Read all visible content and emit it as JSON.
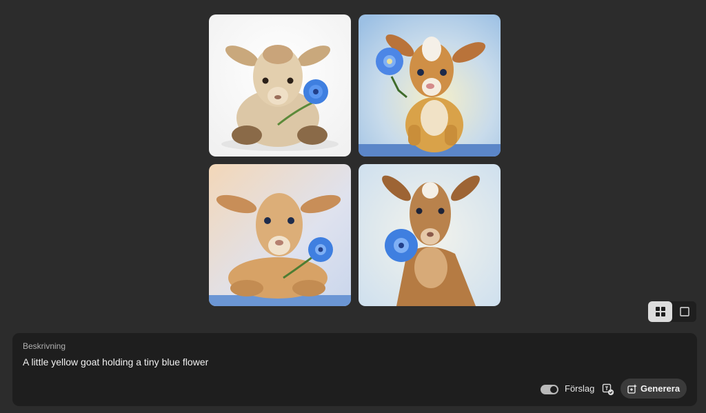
{
  "gallery": {
    "images": [
      {
        "name": "goat-image-1"
      },
      {
        "name": "goat-image-2"
      },
      {
        "name": "goat-image-3"
      },
      {
        "name": "goat-image-4"
      }
    ]
  },
  "view_toggle": {
    "grid_icon": "grid-view-icon",
    "single_icon": "single-view-icon",
    "selected": "grid"
  },
  "prompt": {
    "label": "Beskrivning",
    "text": "A little yellow goat holding a tiny blue flower"
  },
  "actions": {
    "suggestions_label": "Förslag",
    "suggestions_enabled": true,
    "credits_icon": "credits-check-icon",
    "generate_label": "Generera",
    "generate_icon": "generate-sparkle-icon"
  },
  "colors": {
    "background": "#2c2c2c",
    "panel": "#1e1e1e",
    "button": "#3a3a3a",
    "flower_blue": "#3f7fe0"
  }
}
